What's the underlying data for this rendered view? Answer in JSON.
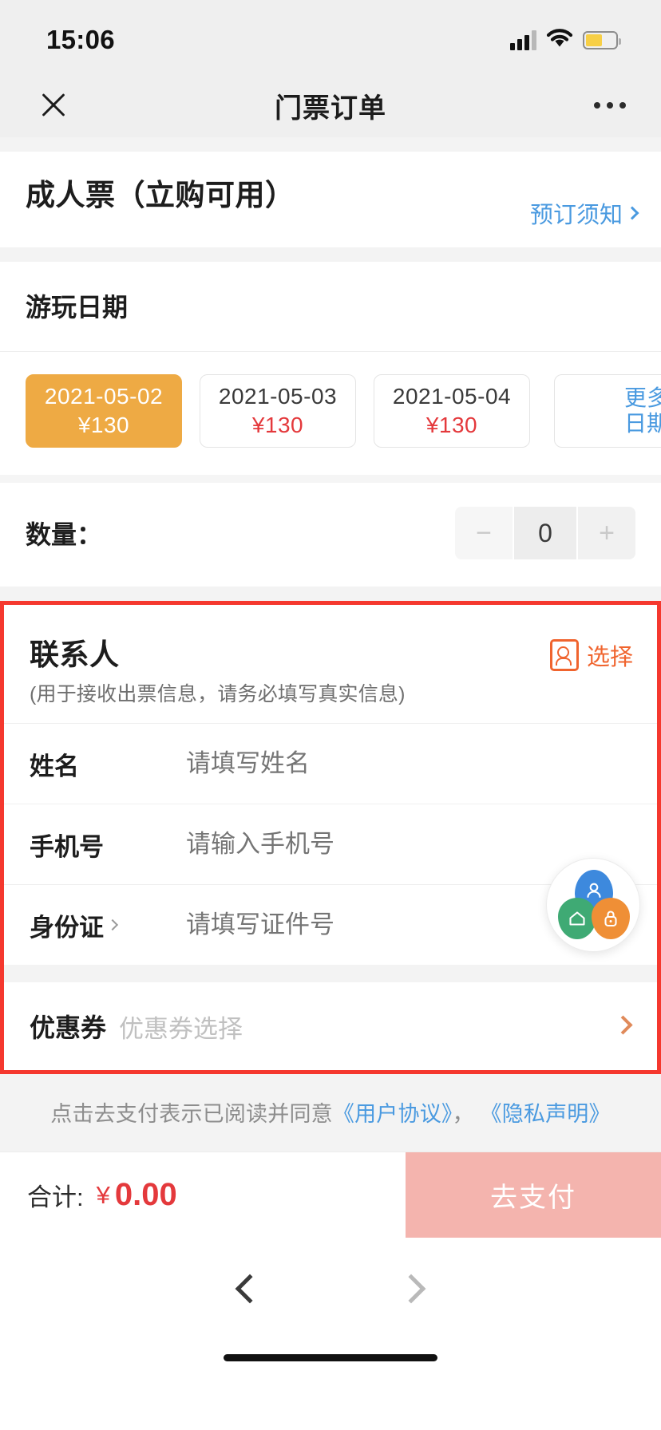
{
  "statusbar": {
    "time": "15:06",
    "signal_icon": "cellular-bars-icon",
    "wifi_icon": "wifi-icon",
    "battery_icon": "battery-low-power-icon"
  },
  "navbar": {
    "close_icon": "close-icon",
    "title": "门票订单",
    "more_icon": "more-options-icon"
  },
  "product": {
    "title": "成人票（立购可用）",
    "notice_link": "预订须知"
  },
  "date_section": {
    "header": "游玩日期",
    "currency": "¥",
    "chips": [
      {
        "date": "2021-05-02",
        "price": "¥130",
        "selected": true
      },
      {
        "date": "2021-05-03",
        "price": "¥130",
        "selected": false
      },
      {
        "date": "2021-05-04",
        "price": "¥130",
        "selected": false
      }
    ],
    "more_label": "更多\n日期"
  },
  "quantity": {
    "label": "数量：",
    "minus_label": "−",
    "value": "0",
    "plus_label": "+"
  },
  "contact": {
    "title": "联系人",
    "subtitle": "(用于接收出票信息，请务必填写真实信息)",
    "pick_icon": "contact-card-icon",
    "pick_label": "选择",
    "fields": [
      {
        "label": "姓名",
        "placeholder": "请填写姓名",
        "value": "",
        "has_chevron": false
      },
      {
        "label": "手机号",
        "placeholder": "请输入手机号",
        "value": "",
        "has_chevron": false
      },
      {
        "label": "身份证",
        "placeholder": "请填写证件号",
        "value": "",
        "has_chevron": true
      }
    ],
    "coupon": {
      "label": "优惠券",
      "placeholder": "优惠券选择",
      "chevron_icon": "chevron-right-icon"
    }
  },
  "float_ball": {
    "name": "floating-assistant-button",
    "petals": [
      {
        "color": "#3d89dd",
        "icon": "person-icon"
      },
      {
        "color": "#3faa74",
        "icon": "home-icon"
      },
      {
        "color": "#ef8f36",
        "icon": "lock-icon"
      }
    ]
  },
  "agreement": {
    "prefix": "点击去支付表示已阅读并同意",
    "link1": "《用户协议》",
    "separator": "，",
    "link2": "《隐私声明》"
  },
  "bottom": {
    "total_label": "合计:",
    "currency": "¥",
    "total_value": "0.00",
    "pay_label": "去支付"
  },
  "browser_nav": {
    "back_icon": "chevron-left-icon",
    "forward_icon": "chevron-right-icon"
  },
  "colors": {
    "accent_orange": "#eeaa44",
    "price_red": "#e4393c",
    "link_blue": "#4a9ae0",
    "highlight_red": "#f5382e",
    "pay_button": "#f4b4ae"
  }
}
